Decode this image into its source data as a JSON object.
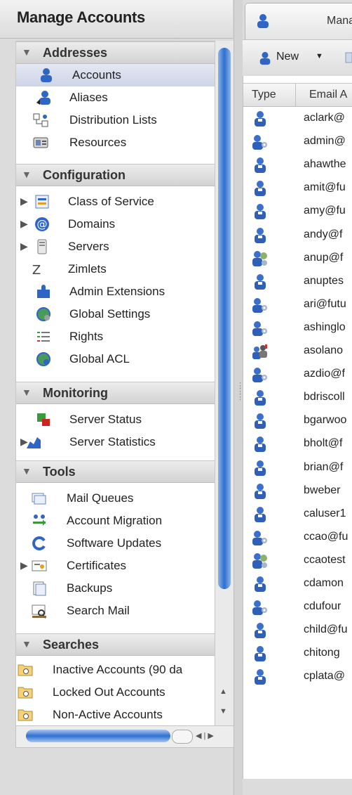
{
  "left_panel": {
    "title": "Manage Accounts",
    "sections": [
      {
        "label": "Addresses",
        "items": [
          {
            "label": "Accounts",
            "icon": "person-icon",
            "selected": true
          },
          {
            "label": "Aliases",
            "icon": "alias-icon"
          },
          {
            "label": "Distribution Lists",
            "icon": "distribution-list-icon"
          },
          {
            "label": "Resources",
            "icon": "resources-icon"
          }
        ]
      },
      {
        "label": "Configuration",
        "items": [
          {
            "label": "Class of Service",
            "icon": "class-of-service-icon",
            "expandable": true
          },
          {
            "label": "Domains",
            "icon": "at-icon",
            "expandable": true
          },
          {
            "label": "Servers",
            "icon": "server-icon",
            "expandable": true
          },
          {
            "label": "Zimlets",
            "icon": "zimlet-icon"
          },
          {
            "label": "Admin Extensions",
            "icon": "puzzle-icon"
          },
          {
            "label": "Global Settings",
            "icon": "globe-settings-icon"
          },
          {
            "label": "Rights",
            "icon": "rights-icon"
          },
          {
            "label": "Global ACL",
            "icon": "globe-acl-icon"
          }
        ]
      },
      {
        "label": "Monitoring",
        "items": [
          {
            "label": "Server Status",
            "icon": "server-status-icon"
          },
          {
            "label": "Server Statistics",
            "icon": "chart-icon",
            "expandable": true
          }
        ]
      },
      {
        "label": "Tools",
        "items": [
          {
            "label": "Mail Queues",
            "icon": "mail-queue-icon"
          },
          {
            "label": "Account Migration",
            "icon": "migration-icon"
          },
          {
            "label": "Software Updates",
            "icon": "refresh-icon"
          },
          {
            "label": "Certificates",
            "icon": "certificate-icon",
            "expandable": true
          },
          {
            "label": "Backups",
            "icon": "backup-icon"
          },
          {
            "label": "Search Mail",
            "icon": "search-mail-icon"
          }
        ]
      },
      {
        "label": "Searches",
        "items": [
          {
            "label": "Inactive Accounts (90 da",
            "icon": "folder-search-icon"
          },
          {
            "label": "Locked Out Accounts",
            "icon": "folder-search-icon"
          },
          {
            "label": "Non-Active Accounts",
            "icon": "folder-search-icon"
          }
        ]
      }
    ]
  },
  "right_panel": {
    "tab_label": "Mana",
    "toolbar": {
      "new_label": "New"
    },
    "columns": {
      "type": "Type",
      "email": "Email A"
    },
    "rows": [
      {
        "icon": "user",
        "email": "aclark@"
      },
      {
        "icon": "admin",
        "email": "admin@"
      },
      {
        "icon": "user",
        "email": "ahawthe"
      },
      {
        "icon": "user",
        "email": "amit@fu"
      },
      {
        "icon": "user",
        "email": "amy@fu"
      },
      {
        "icon": "user",
        "email": "andy@f"
      },
      {
        "icon": "globaladmin",
        "email": "anup@f"
      },
      {
        "icon": "user",
        "email": "anuptes"
      },
      {
        "icon": "admin",
        "email": "ari@futu"
      },
      {
        "icon": "admin",
        "email": "ashinglo"
      },
      {
        "icon": "alias",
        "email": "asolano"
      },
      {
        "icon": "admin",
        "email": "azdio@f"
      },
      {
        "icon": "user",
        "email": "bdriscoll"
      },
      {
        "icon": "user",
        "email": "bgarwoo"
      },
      {
        "icon": "user",
        "email": "bholt@f"
      },
      {
        "icon": "user",
        "email": "brian@f"
      },
      {
        "icon": "user",
        "email": "bweber"
      },
      {
        "icon": "user",
        "email": "caluser1"
      },
      {
        "icon": "admin",
        "email": "ccao@fu"
      },
      {
        "icon": "globaladmin",
        "email": "ccaotest"
      },
      {
        "icon": "user",
        "email": "cdamon"
      },
      {
        "icon": "admin",
        "email": "cdufour"
      },
      {
        "icon": "user",
        "email": "child@fu"
      },
      {
        "icon": "user",
        "email": "chitong"
      },
      {
        "icon": "user",
        "email": "cplata@"
      }
    ]
  },
  "colors": {
    "accent": "#2e6fd0",
    "user_icon": "#2f66c6"
  }
}
